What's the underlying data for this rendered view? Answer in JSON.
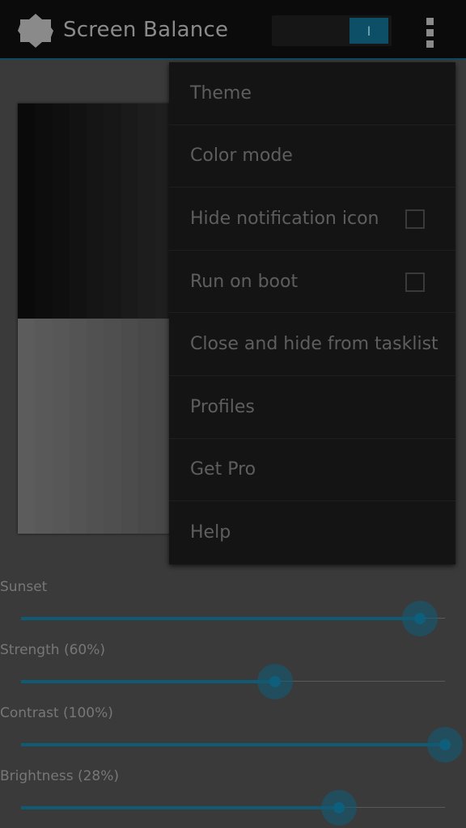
{
  "app": {
    "title": "Screen Balance",
    "toggle_label": "I",
    "icons": {
      "app": "app-logo-icon",
      "overflow": "overflow-menu-icon"
    },
    "colors": {
      "accent": "#0f5a74",
      "actionbar": "#0b0b0b",
      "menu": "#141414"
    }
  },
  "sliders": [
    {
      "label": "Sunset",
      "value": 0.94
    },
    {
      "label": "Strength (60%)",
      "value": 0.6
    },
    {
      "label": "Contrast (100%)",
      "value": 1.0
    },
    {
      "label": "Brightness (28%)",
      "value": 0.75
    }
  ],
  "menu": {
    "items": [
      {
        "label": "Theme"
      },
      {
        "label": "Color mode"
      },
      {
        "label": "Hide notification icon",
        "checkbox": false
      },
      {
        "label": "Run on boot",
        "checkbox": false
      },
      {
        "label": "Close and hide from tasklist"
      },
      {
        "label": "Profiles"
      },
      {
        "label": "Get Pro"
      },
      {
        "label": "Help"
      }
    ]
  }
}
